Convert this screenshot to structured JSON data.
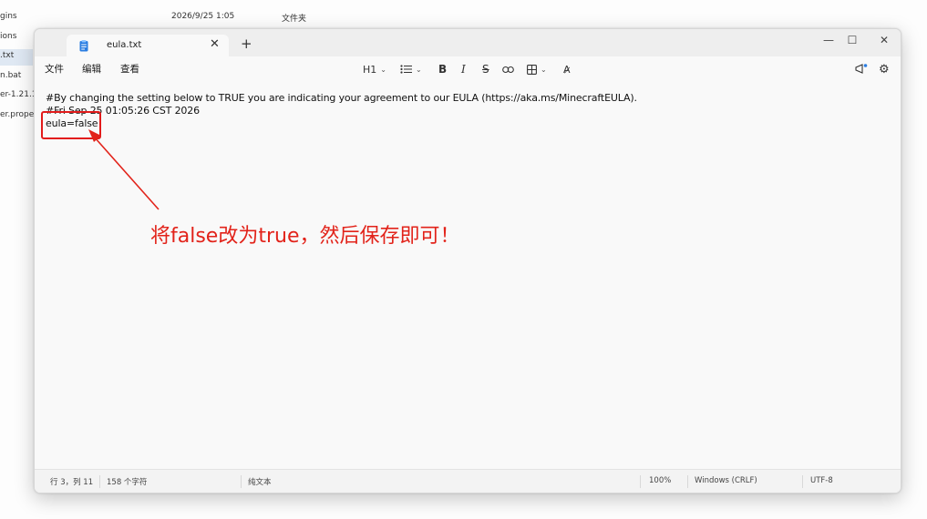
{
  "explorer": {
    "rows": [
      {
        "name": "gins",
        "date": "",
        "type": ""
      },
      {
        "name": "2026/9/25 1:05",
        "date": "",
        "type": "文件夹"
      },
      {
        "name": "ions",
        "date": "",
        "type": ""
      },
      {
        "name": ".txt",
        "date": "",
        "type": ""
      },
      {
        "name": "n.bat",
        "date": "",
        "type": ""
      },
      {
        "name": "er-1.21.1",
        "date": "",
        "type": ""
      },
      {
        "name": "er.proper",
        "date": "",
        "type": ""
      }
    ]
  },
  "notepad": {
    "tab": {
      "title": "eula.txt"
    },
    "menu": {
      "file": "文件",
      "edit": "编辑",
      "view": "查看"
    },
    "toolbar": {
      "heading": "H1"
    },
    "content": {
      "line1": "#By changing the setting below to TRUE you are indicating your agreement to our EULA (https://aka.ms/MinecraftEULA).",
      "line2": "#Fri Sep 25 01:05:26 CST 2026",
      "line3": "eula=false"
    },
    "status": {
      "position": "行 3，列 11",
      "chars": "158 个字符",
      "format": "纯文本",
      "zoom": "100%",
      "line_ending": "Windows (CRLF)",
      "encoding": "UTF-8"
    }
  },
  "annotation": {
    "text": "将false改为true，然后保存即可！",
    "color": "#e2231a"
  }
}
